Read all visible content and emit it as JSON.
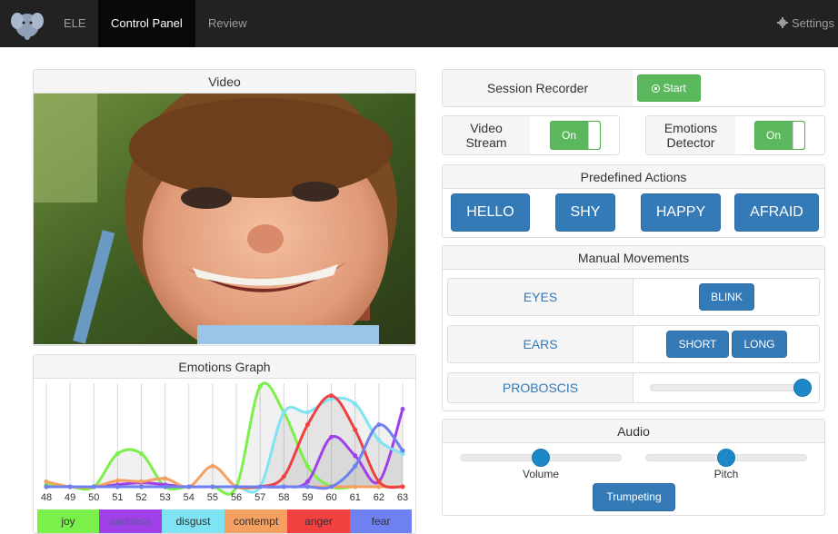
{
  "nav": {
    "items": [
      {
        "label": "ELE",
        "active": false
      },
      {
        "label": "Control Panel",
        "active": true
      },
      {
        "label": "Review",
        "active": false
      }
    ],
    "settings_label": "Settings",
    "logo_icon": "elephant-logo-icon"
  },
  "video": {
    "title": "Video"
  },
  "emotions_graph": {
    "title": "Emotions Graph",
    "legend": [
      {
        "label": "joy",
        "color": "#7cf04a"
      },
      {
        "label": "sadness",
        "color": "#a040e8"
      },
      {
        "label": "disgust",
        "color": "#7fe3f4"
      },
      {
        "label": "contempt",
        "color": "#f4a060"
      },
      {
        "label": "anger",
        "color": "#f04040"
      },
      {
        "label": "fear",
        "color": "#6f80f0"
      }
    ]
  },
  "chart_data": {
    "type": "line",
    "x": [
      48,
      49,
      50,
      51,
      52,
      53,
      54,
      55,
      56,
      57,
      58,
      59,
      60,
      61,
      62,
      63
    ],
    "ylim": [
      0,
      1
    ],
    "grid": true,
    "series": [
      {
        "name": "joy",
        "color": "#7cf04a",
        "values": [
          0.02,
          0.0,
          0.0,
          0.32,
          0.32,
          0.0,
          0.0,
          0.0,
          0.0,
          0.97,
          0.72,
          0.2,
          0.0,
          0.0,
          0.0,
          0.0
        ]
      },
      {
        "name": "sadness",
        "color": "#a040e8",
        "values": [
          0.0,
          0.0,
          0.0,
          0.02,
          0.04,
          0.02,
          0.0,
          0.0,
          0.0,
          0.0,
          0.0,
          0.05,
          0.48,
          0.3,
          0.05,
          0.75
        ]
      },
      {
        "name": "disgust",
        "color": "#7fe3f4",
        "values": [
          0.0,
          0.0,
          0.0,
          0.0,
          0.0,
          0.0,
          0.0,
          0.0,
          0.0,
          0.0,
          0.72,
          0.72,
          0.85,
          0.8,
          0.45,
          0.32
        ]
      },
      {
        "name": "contempt",
        "color": "#f4a060",
        "values": [
          0.05,
          0.0,
          0.0,
          0.06,
          0.05,
          0.08,
          0.0,
          0.2,
          0.0,
          0.0,
          0.0,
          0.0,
          0.0,
          0.0,
          0.0,
          0.0
        ]
      },
      {
        "name": "anger",
        "color": "#f04040",
        "values": [
          0.0,
          0.0,
          0.0,
          0.0,
          0.0,
          0.0,
          0.0,
          0.0,
          0.0,
          0.0,
          0.1,
          0.6,
          0.88,
          0.55,
          0.05,
          0.0
        ]
      },
      {
        "name": "fear",
        "color": "#6f80f0",
        "values": [
          0.0,
          0.0,
          0.0,
          0.0,
          0.0,
          0.0,
          0.0,
          0.0,
          0.0,
          0.0,
          0.0,
          0.0,
          0.0,
          0.2,
          0.6,
          0.35
        ]
      }
    ]
  },
  "session": {
    "label": "Session Recorder",
    "start_label": "Start"
  },
  "video_stream": {
    "label_line1": "Video",
    "label_line2": "Stream",
    "toggle": "On"
  },
  "emotions_detector": {
    "label_line1": "Emotions",
    "label_line2": "Detector",
    "toggle": "On"
  },
  "predefined": {
    "title": "Predefined Actions",
    "actions": [
      "HELLO",
      "SHY",
      "HAPPY",
      "AFRAID"
    ]
  },
  "manual": {
    "title": "Manual Movements",
    "eyes": {
      "label": "EYES",
      "buttons": [
        "BLINK"
      ]
    },
    "ears": {
      "label": "EARS",
      "buttons": [
        "SHORT",
        "LONG"
      ]
    },
    "proboscis": {
      "label": "PROBOSCIS",
      "value": 1.0
    }
  },
  "audio": {
    "title": "Audio",
    "volume_label": "Volume",
    "volume_value": 0.5,
    "pitch_label": "Pitch",
    "pitch_value": 0.5,
    "trumpet_label": "Trumpeting"
  },
  "colors": {
    "primary": "#337ab7",
    "success": "#5cb85c",
    "navbar": "#222222"
  }
}
